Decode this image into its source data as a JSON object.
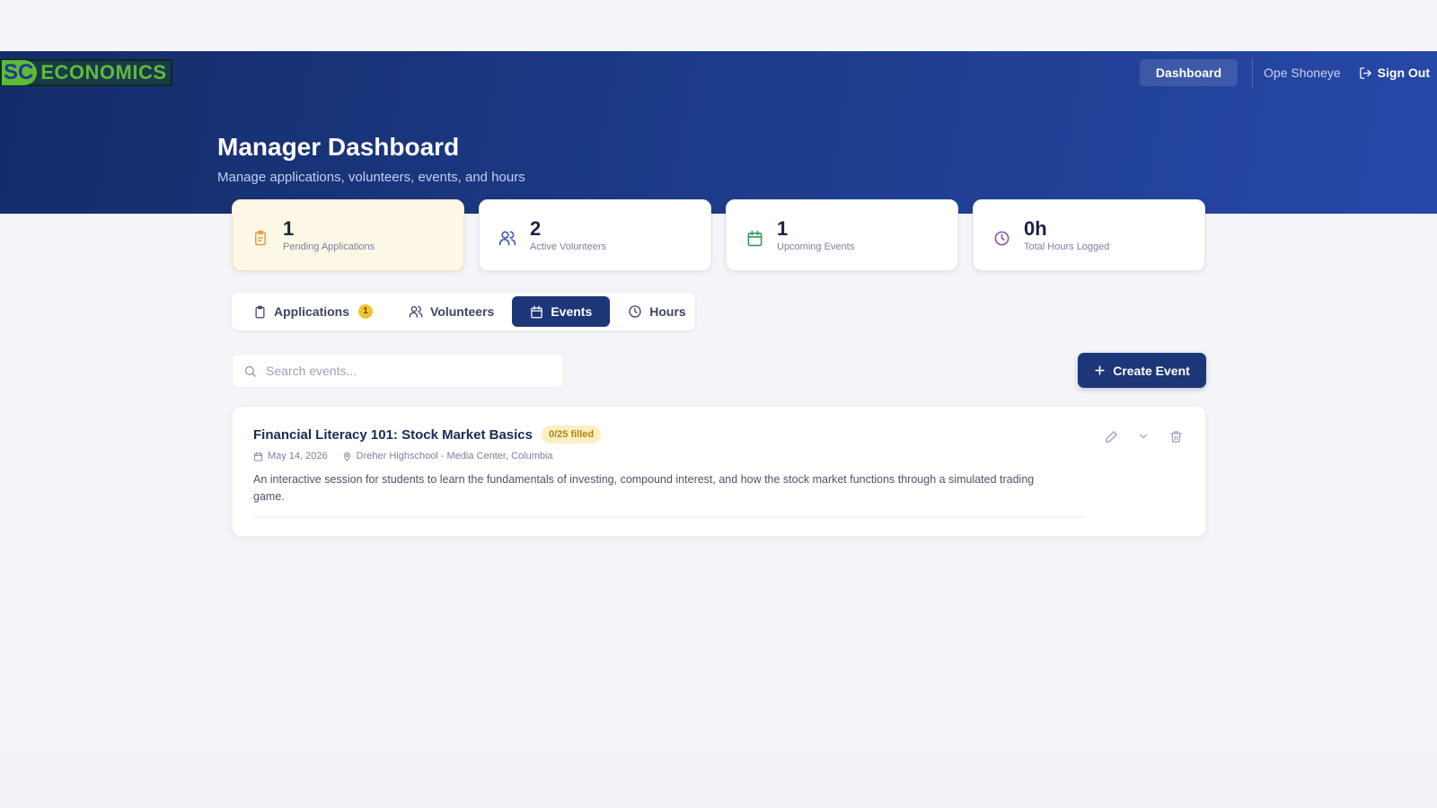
{
  "brand": {
    "logo_prefix": "SC",
    "logo_text": "ECONOMICS"
  },
  "nav": {
    "dashboard": "Dashboard",
    "user": "Ope Shoneye",
    "sign_out": "Sign Out"
  },
  "header": {
    "title": "Manager Dashboard",
    "subtitle": "Manage applications, volunteers, events, and hours"
  },
  "stats": [
    {
      "value": "1",
      "label": "Pending Applications",
      "icon": "clipboard-icon",
      "color": "#e0a23a"
    },
    {
      "value": "2",
      "label": "Active Volunteers",
      "icon": "users-icon",
      "color": "#3c5bb3"
    },
    {
      "value": "1",
      "label": "Upcoming Events",
      "icon": "calendar-icon",
      "color": "#2e9a5a"
    },
    {
      "value": "0h",
      "label": "Total Hours Logged",
      "icon": "clock-icon",
      "color": "#8a4fb8"
    }
  ],
  "tabs": [
    {
      "label": "Applications",
      "badge": "1",
      "icon": "clipboard-icon",
      "active": false
    },
    {
      "label": "Volunteers",
      "icon": "users-icon",
      "active": false
    },
    {
      "label": "Events",
      "icon": "calendar-icon",
      "active": true
    },
    {
      "label": "Hours",
      "icon": "clock-icon",
      "active": false
    }
  ],
  "search": {
    "placeholder": "Search events..."
  },
  "create_button": "Create Event",
  "events": [
    {
      "title": "Financial Literacy 101: Stock Market Basics",
      "badge": "0/25 filled",
      "date": "May 14, 2026",
      "location": "Dreher Highschool - Media Center, Columbia",
      "description": "An interactive session for students to learn the fundamentals of investing, compound interest, and how the stock market functions through a simulated trading game."
    }
  ],
  "colors": {
    "primary": "#1c3677",
    "hero_start": "#152c6a",
    "hero_end": "#2748a8",
    "badge_yellow": "#f3c233",
    "brand_green": "#5dbb3b"
  }
}
